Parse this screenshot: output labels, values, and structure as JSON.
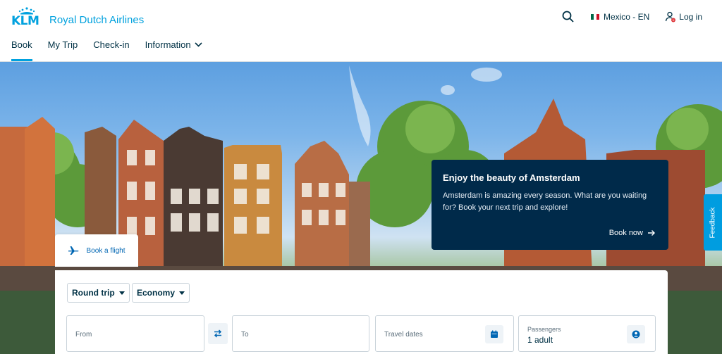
{
  "brand": {
    "short": "KLM",
    "name": "Royal Dutch Airlines",
    "color": "#00a1de"
  },
  "nav": {
    "items": [
      {
        "label": "Book",
        "active": true
      },
      {
        "label": "My Trip",
        "active": false
      },
      {
        "label": "Check-in",
        "active": false
      },
      {
        "label": "Information",
        "active": false,
        "has_dropdown": true
      }
    ]
  },
  "top_actions": {
    "search_icon": "search-icon",
    "locale_label": "Mexico - EN",
    "flag": "mexico-flag-icon",
    "login_label": "Log in"
  },
  "promo": {
    "title": "Enjoy the beauty of Amsterdam",
    "text": "Amsterdam is amazing every season. What are you waiting for? Book your next trip and explore!",
    "cta": "Book now",
    "background": "#002a4a"
  },
  "feedback": {
    "label": "Feedback",
    "color": "#009de0"
  },
  "booking": {
    "tab_label": "Book a flight",
    "trip_type": "Round trip",
    "cabin_class": "Economy",
    "from_placeholder": "From",
    "to_placeholder": "To",
    "dates_placeholder": "Travel dates",
    "passengers_label": "Passengers",
    "passengers_value": "1 adult"
  }
}
